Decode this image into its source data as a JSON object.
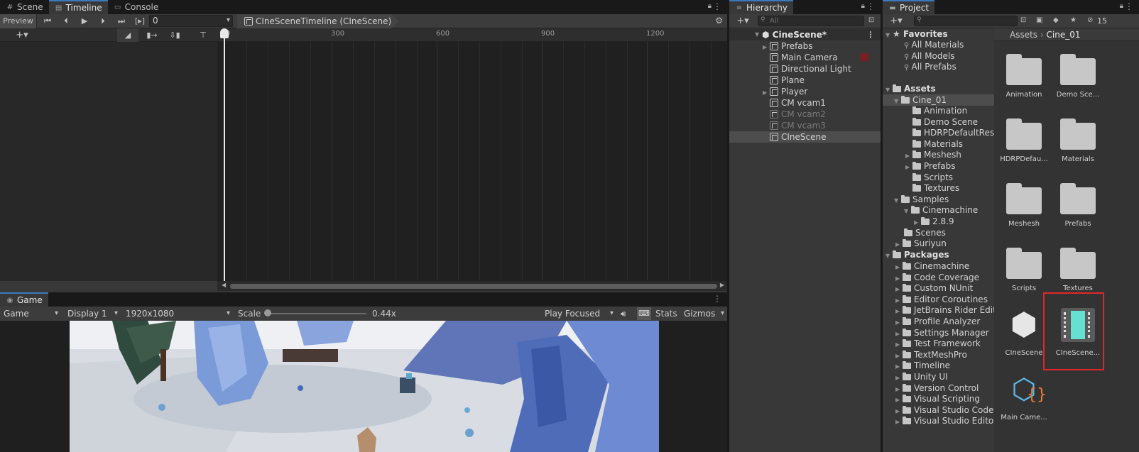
{
  "tabs_top": {
    "scene": "Scene",
    "timeline": "Timeline",
    "console": "Console"
  },
  "timeline": {
    "preview_label": "Preview",
    "frame_value": "0",
    "breadcrumb": "CIneSceneTimeline (CIneScene)",
    "ruler_ticks": [
      "0",
      "300",
      "600",
      "900",
      "1200"
    ]
  },
  "game": {
    "tab": "Game",
    "mode": "Game",
    "display": "Display 1",
    "resolution": "1920x1080",
    "scale_label": "Scale",
    "scale_value": "0.44x",
    "play_focused": "Play Focused",
    "stats": "Stats",
    "gizmos": "Gizmos"
  },
  "hierarchy": {
    "tab": "Hierarchy",
    "search_placeholder": "All",
    "scene_name": "CineScene*",
    "items": [
      {
        "label": "Prefabs",
        "fold": true,
        "dim": false
      },
      {
        "label": "Main Camera",
        "fold": false,
        "dim": false
      },
      {
        "label": "Directional Light",
        "fold": false,
        "dim": false
      },
      {
        "label": "Plane",
        "fold": false,
        "dim": false
      },
      {
        "label": "Player",
        "fold": true,
        "dim": false
      },
      {
        "label": "CM vcam1",
        "fold": false,
        "dim": false
      },
      {
        "label": "CM vcam2",
        "fold": false,
        "dim": true
      },
      {
        "label": "CM vcam3",
        "fold": false,
        "dim": true
      },
      {
        "label": "CIneScene",
        "fold": false,
        "dim": false
      }
    ]
  },
  "project": {
    "tab": "Project",
    "hidden_count": "15",
    "breadcrumb": [
      "Assets",
      "Cine_01"
    ],
    "favorites": {
      "label": "Favorites",
      "items": [
        "All Materials",
        "All Models",
        "All Prefabs"
      ]
    },
    "assets_label": "Assets",
    "tree": [
      {
        "label": "Cine_01",
        "level": 1,
        "fold": "open"
      },
      {
        "label": "Animation",
        "level": 2,
        "fold": ""
      },
      {
        "label": "Demo Scene",
        "level": 2,
        "fold": ""
      },
      {
        "label": "HDRPDefaultRes",
        "level": 2,
        "fold": ""
      },
      {
        "label": "Materials",
        "level": 2,
        "fold": ""
      },
      {
        "label": "Meshesh",
        "level": 2,
        "fold": "closed"
      },
      {
        "label": "Prefabs",
        "level": 2,
        "fold": "closed"
      },
      {
        "label": "Scripts",
        "level": 2,
        "fold": ""
      },
      {
        "label": "Textures",
        "level": 2,
        "fold": ""
      },
      {
        "label": "Samples",
        "level": 1,
        "fold": "open"
      },
      {
        "label": "Cinemachine",
        "level": 2,
        "fold": "open"
      },
      {
        "label": "2.8.9",
        "level": 3,
        "fold": "closed"
      },
      {
        "label": "Scenes",
        "level": 1,
        "fold": ""
      },
      {
        "label": "Suriyun",
        "level": 1,
        "fold": "closed"
      }
    ],
    "packages_label": "Packages",
    "packages": [
      "Cinemachine",
      "Code Coverage",
      "Custom NUnit",
      "Editor Coroutines",
      "JetBrains Rider Edit",
      "Profile Analyzer",
      "Settings Manager",
      "Test Framework",
      "TextMeshPro",
      "Timeline",
      "Unity UI",
      "Version Control",
      "Visual Scripting",
      "Visual Studio Code",
      "Visual Studio Editor"
    ],
    "grid": [
      "Animation",
      "Demo Sce...",
      "HDRPDefau...",
      "Materials",
      "Meshesh",
      "Prefabs",
      "Scripts",
      "Textures",
      "CIneScene",
      "CIneScene...",
      "Main Came..."
    ]
  }
}
